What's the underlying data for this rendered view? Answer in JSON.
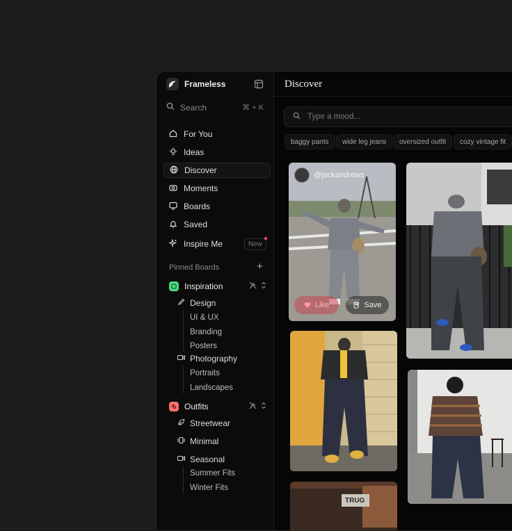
{
  "app": {
    "name": "Frameless"
  },
  "search": {
    "label": "Search",
    "shortcut": "⌘ + K"
  },
  "nav": [
    {
      "label": "For You",
      "icon": "home-icon"
    },
    {
      "label": "Ideas",
      "icon": "lightbulb-icon"
    },
    {
      "label": "Discover",
      "icon": "globe-icon",
      "active": true
    },
    {
      "label": "Moments",
      "icon": "camera-icon"
    },
    {
      "label": "Boards",
      "icon": "board-icon"
    },
    {
      "label": "Saved",
      "icon": "bell-icon"
    },
    {
      "label": "Inspire Me",
      "icon": "sparkle-icon",
      "badge": "New"
    }
  ],
  "pinned": {
    "label": "Pinned Boards",
    "boards": [
      {
        "name": "Inspiration",
        "color": "#4ade80",
        "subs": [
          {
            "name": "Design",
            "icon": "pen-icon",
            "leaves": [
              "UI & UX",
              "Branding",
              "Posters"
            ]
          },
          {
            "name": "Photography",
            "icon": "video-icon",
            "leaves": [
              "Portraits",
              "Landscapes"
            ]
          }
        ]
      },
      {
        "name": "Outfits",
        "color": "#f87171",
        "subs": [
          {
            "name": "Streetwear",
            "icon": "leaf-icon",
            "leaves": []
          },
          {
            "name": "Minimal",
            "icon": "layers-icon",
            "leaves": []
          },
          {
            "name": "Seasonal",
            "icon": "video-icon",
            "leaves": [
              "Summer Fits",
              "Winter Fits"
            ]
          }
        ]
      }
    ]
  },
  "main": {
    "title": "Discover",
    "mood_placeholder": "Type a mood...",
    "chips": [
      "baggy pants",
      "wide leg jeans",
      "oversized outfit",
      "cozy vintage fit"
    ],
    "card": {
      "user": "@jackandrews",
      "like": "Like",
      "save": "Save"
    },
    "sign_text": "TRUG"
  }
}
